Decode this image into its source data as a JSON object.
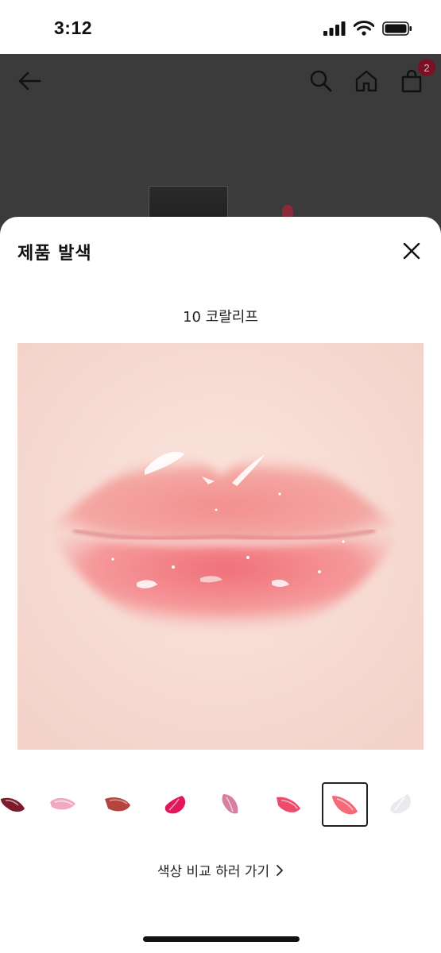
{
  "status_bar": {
    "time": "3:12"
  },
  "header": {
    "cart_count": "2"
  },
  "sheet": {
    "title": "제품 발색",
    "shade_name": "10 코랄리프",
    "compare_label": "색상 비교 하러 가기"
  },
  "swatches": [
    {
      "name": "swatch-1",
      "color": "#7e1a2a"
    },
    {
      "name": "swatch-2",
      "color": "#f2a9c0"
    },
    {
      "name": "swatch-3",
      "color": "#b3443f"
    },
    {
      "name": "swatch-4",
      "color": "#e0185a"
    },
    {
      "name": "swatch-5",
      "color": "#d77fa2"
    },
    {
      "name": "swatch-6",
      "color": "#ee4b6b"
    },
    {
      "name": "swatch-7",
      "color": "#f46a78",
      "selected": true
    },
    {
      "name": "swatch-8",
      "color": "#e9e9ef"
    }
  ],
  "colors": {
    "accent": "#7a1023",
    "scrim": "#3a3a3a"
  }
}
